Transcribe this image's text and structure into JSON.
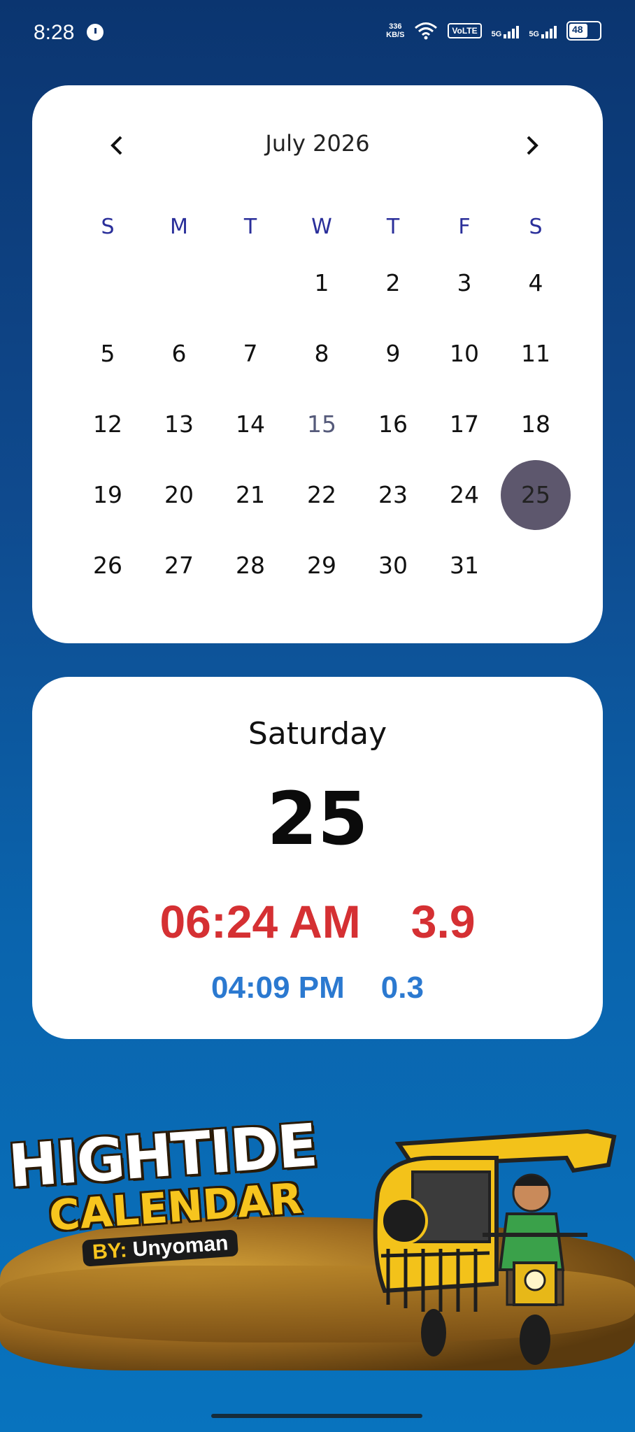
{
  "status_bar": {
    "time": "8:28",
    "net_speed_value": "336",
    "net_speed_unit": "KB/S",
    "volte": "VoLTE",
    "sim1_label": "5G",
    "sim2_label": "5G",
    "battery": "48"
  },
  "calendar": {
    "month_label": "July 2026",
    "prev_icon": "chevron-left",
    "next_icon": "chevron-right",
    "weekdays": [
      "S",
      "M",
      "T",
      "W",
      "T",
      "F",
      "S"
    ],
    "weeks": [
      [
        "",
        "",
        "",
        "1",
        "2",
        "3",
        "4"
      ],
      [
        "5",
        "6",
        "7",
        "8",
        "9",
        "10",
        "11"
      ],
      [
        "12",
        "13",
        "14",
        "15",
        "16",
        "17",
        "18"
      ],
      [
        "19",
        "20",
        "21",
        "22",
        "23",
        "24",
        "25"
      ],
      [
        "26",
        "27",
        "28",
        "29",
        "30",
        "31",
        ""
      ]
    ],
    "today": "15",
    "selected": "25",
    "colors": {
      "weekday": "#2a2f9a",
      "selected_bg": "#5d576d"
    }
  },
  "tide": {
    "day_name": "Saturday",
    "date": "25",
    "high_time": "06:24 AM",
    "high_height": "3.9",
    "low_time": "04:09 PM",
    "low_height": "0.3",
    "colors": {
      "high": "#d53033",
      "low": "#2b79d0"
    }
  },
  "banner": {
    "title_line1": "HIGHTIDE",
    "title_line2": "CALENDAR",
    "by_label": "BY:",
    "author": "Unyoman",
    "illustration": "tricycle-driver-illustration"
  }
}
